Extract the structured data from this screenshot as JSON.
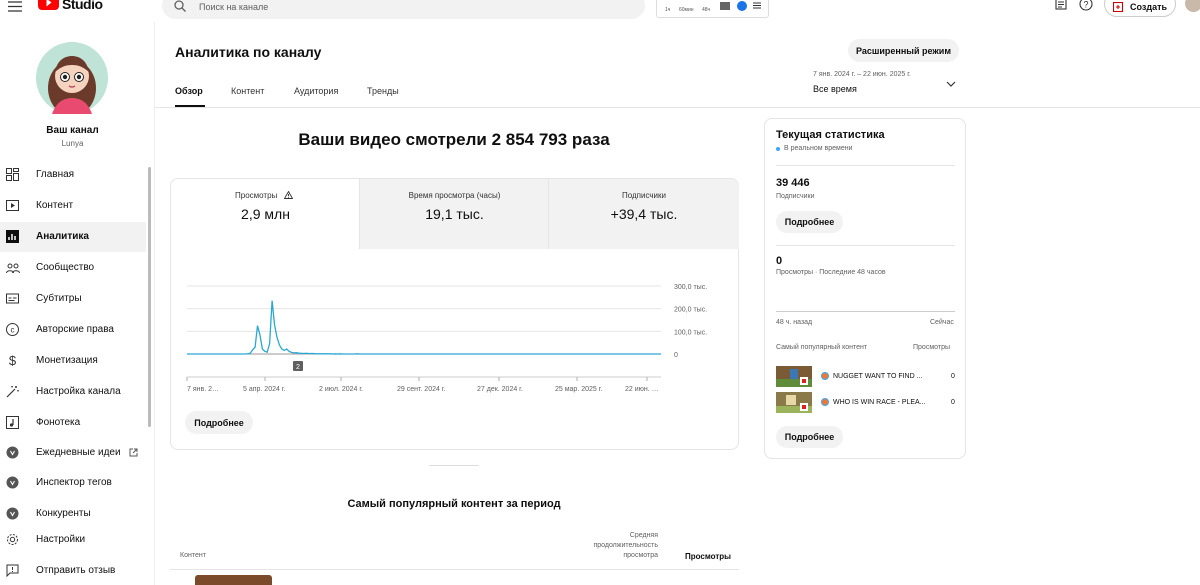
{
  "header": {
    "logo_text": "Studio",
    "search_placeholder": "Поиск на канале",
    "create_label": "Создать",
    "ext_stats": [
      "1ч",
      "60мин",
      "48ч"
    ]
  },
  "sidebar": {
    "channel_name": "Ваш канал",
    "channel_handle": "Lunya",
    "items": [
      {
        "label": "Главная",
        "icon": "dashboard-icon"
      },
      {
        "label": "Контент",
        "icon": "content-icon"
      },
      {
        "label": "Аналитика",
        "icon": "analytics-icon",
        "active": true
      },
      {
        "label": "Сообщество",
        "icon": "community-icon"
      },
      {
        "label": "Субтитры",
        "icon": "subtitles-icon"
      },
      {
        "label": "Авторские права",
        "icon": "copyright-icon"
      },
      {
        "label": "Монетизация",
        "icon": "dollar-icon"
      },
      {
        "label": "Настройка канала",
        "icon": "magic-wand-icon"
      },
      {
        "label": "Фонотека",
        "icon": "audio-library-icon"
      },
      {
        "label": "Ежедневные идеи",
        "icon": "vidiq-icon",
        "external": true
      },
      {
        "label": "Инспектор тегов",
        "icon": "vidiq-icon"
      },
      {
        "label": "Конкуренты",
        "icon": "vidiq-icon"
      },
      {
        "label": "Настройки",
        "icon": "gear-icon"
      },
      {
        "label": "Отправить отзыв",
        "icon": "feedback-icon"
      }
    ]
  },
  "page": {
    "title": "Аналитика по каналу",
    "advanced_mode": "Расширенный режим",
    "date_range": "7 янв. 2024 г. – 22 июн. 2025 г.",
    "period": "Все время",
    "tabs": [
      {
        "label": "Обзор",
        "active": true
      },
      {
        "label": "Контент"
      },
      {
        "label": "Аудитория"
      },
      {
        "label": "Тренды"
      }
    ]
  },
  "overview": {
    "headline": "Ваши видео смотрели 2 854 793 раза",
    "metrics": [
      {
        "label": "Просмотры",
        "value": "2,9 млн",
        "warn": true,
        "selected": true
      },
      {
        "label": "Время просмотра (часы)",
        "value": "19,1 тыс."
      },
      {
        "label": "Подписчики",
        "value": "+39,4 тыс."
      }
    ],
    "more_label": "Подробнее"
  },
  "chart_data": {
    "type": "line",
    "series": [
      {
        "values": [
          0,
          0,
          0,
          0,
          0,
          0,
          0,
          0,
          0,
          0,
          0,
          0,
          0,
          0,
          0,
          0,
          0,
          0,
          0,
          0,
          0,
          0,
          0,
          0,
          0,
          1,
          3,
          18,
          30,
          125,
          85,
          22,
          12,
          8,
          45,
          235,
          130,
          75,
          40,
          22,
          16,
          22,
          12,
          7,
          5,
          6,
          4,
          3,
          2,
          3,
          2,
          2,
          2,
          1,
          1,
          1,
          1,
          1,
          1,
          1,
          0,
          1,
          0,
          1,
          0,
          0,
          0,
          0,
          0,
          0,
          1,
          0,
          0,
          0,
          0,
          0,
          0,
          0,
          0,
          0,
          0,
          0,
          0,
          0,
          0,
          0,
          0,
          0,
          0,
          0,
          0,
          0,
          0,
          0,
          0,
          0,
          0,
          0,
          0,
          0,
          0,
          0,
          0,
          0,
          0,
          0,
          0,
          0,
          0,
          0,
          0,
          0,
          0,
          0,
          0,
          0,
          0,
          0,
          0,
          0,
          0,
          0,
          0,
          0,
          0,
          0,
          0,
          0,
          0,
          0,
          0,
          0,
          0,
          0,
          0,
          0,
          0,
          0,
          0,
          0,
          0,
          0,
          0,
          0,
          0,
          0,
          0,
          0,
          0,
          0,
          0,
          0,
          0,
          0,
          0,
          0,
          0,
          0,
          0,
          0,
          0,
          0,
          0,
          0,
          0,
          0,
          0,
          0,
          0,
          0,
          0,
          0,
          0,
          0,
          0,
          0,
          0,
          0,
          0,
          0,
          0,
          0,
          0,
          0,
          0,
          0,
          0,
          0,
          0,
          0,
          0,
          0,
          0,
          0,
          0,
          0
        ]
      }
    ],
    "x_ticks": [
      "7 янв. 2…",
      "5 апр. 2024 г.",
      "2 июл. 2024 г.",
      "29 сент. 2024 г.",
      "27 дек. 2024 г.",
      "25 мар. 2025 г.",
      "22 июн. …"
    ],
    "y_ticks": [
      "300,0 тыс.",
      "200,0 тыс.",
      "100,0 тыс.",
      "0"
    ],
    "ylim": [
      0,
      300
    ],
    "marker_label": "2"
  },
  "realtime": {
    "title": "Текущая статистика",
    "live": "В реальном времени",
    "subs_value": "39 446",
    "subs_label": "Подписчики",
    "more1": "Подробнее",
    "views_value": "0",
    "views_label": "Просмотры · Последние 48 часов",
    "axis_left": "48 ч. назад",
    "axis_right": "Сейчас",
    "col_content": "Самый популярный контент",
    "col_views": "Просмотры",
    "videos": [
      {
        "title": "NUGGET WANT TO FIND ...",
        "views": "0"
      },
      {
        "title": "WHO IS WIN RACE - PLEA...",
        "views": "0"
      }
    ],
    "more2": "Подробнее"
  },
  "top_content": {
    "title": "Самый популярный контент за период",
    "col_content": "Контент",
    "col_duration": "Средняя продолжительность просмотра",
    "col_views": "Просмотры"
  },
  "colors": {
    "accent": "#3ea6ff",
    "line": "#2aa8d2",
    "red": "#ff0000"
  }
}
